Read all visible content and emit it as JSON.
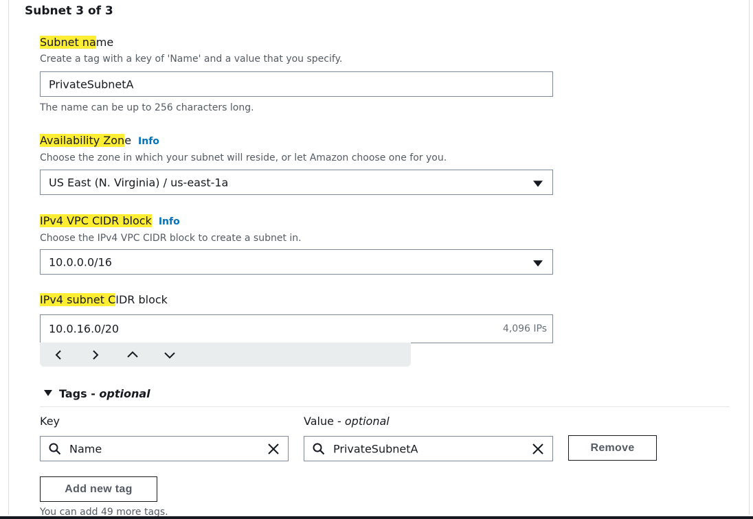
{
  "section": {
    "title": "Subnet 3 of 3"
  },
  "subnet_name": {
    "label_highlight": "Subnet na",
    "label_rest": "me",
    "description": "Create a tag with a key of 'Name' and a value that you specify.",
    "value": "PrivateSubnetA",
    "hint": "The name can be up to 256 characters long."
  },
  "availability_zone": {
    "label_highlight": "Availability Zon",
    "label_rest": "e",
    "info": "Info",
    "description": "Choose the zone in which your subnet will reside, or let Amazon choose one for you.",
    "value": "US East (N. Virginia) / us-east-1a"
  },
  "vpc_cidr": {
    "label_highlight": "IPv4 VPC CIDR block",
    "label_rest": "",
    "info": "Info",
    "description": "Choose the IPv4 VPC CIDR block to create a subnet in.",
    "value": "10.0.0.0/16"
  },
  "subnet_cidr": {
    "label_highlight": "IPv4 subnet C",
    "label_rest": "IDR block",
    "value": "10.0.16.0/20",
    "suffix": "4,096 IPs",
    "stepper_icons": [
      "chevron-left-icon",
      "chevron-right-icon",
      "chevron-up-icon",
      "chevron-down-icon"
    ]
  },
  "tags": {
    "toggle_label": "Tags - ",
    "toggle_optional": "optional",
    "key_header": "Key",
    "value_header_prefix": "Value - ",
    "value_header_optional": "optional",
    "key_value": "Name",
    "value_value": "PrivateSubnetA",
    "remove_label": "Remove",
    "add_label": "Add new tag",
    "footer": "You can add 49 more tags."
  },
  "colors": {
    "highlight": "#ffee33",
    "link": "#0073bb",
    "text": "#16191f",
    "muted": "#545b64"
  }
}
